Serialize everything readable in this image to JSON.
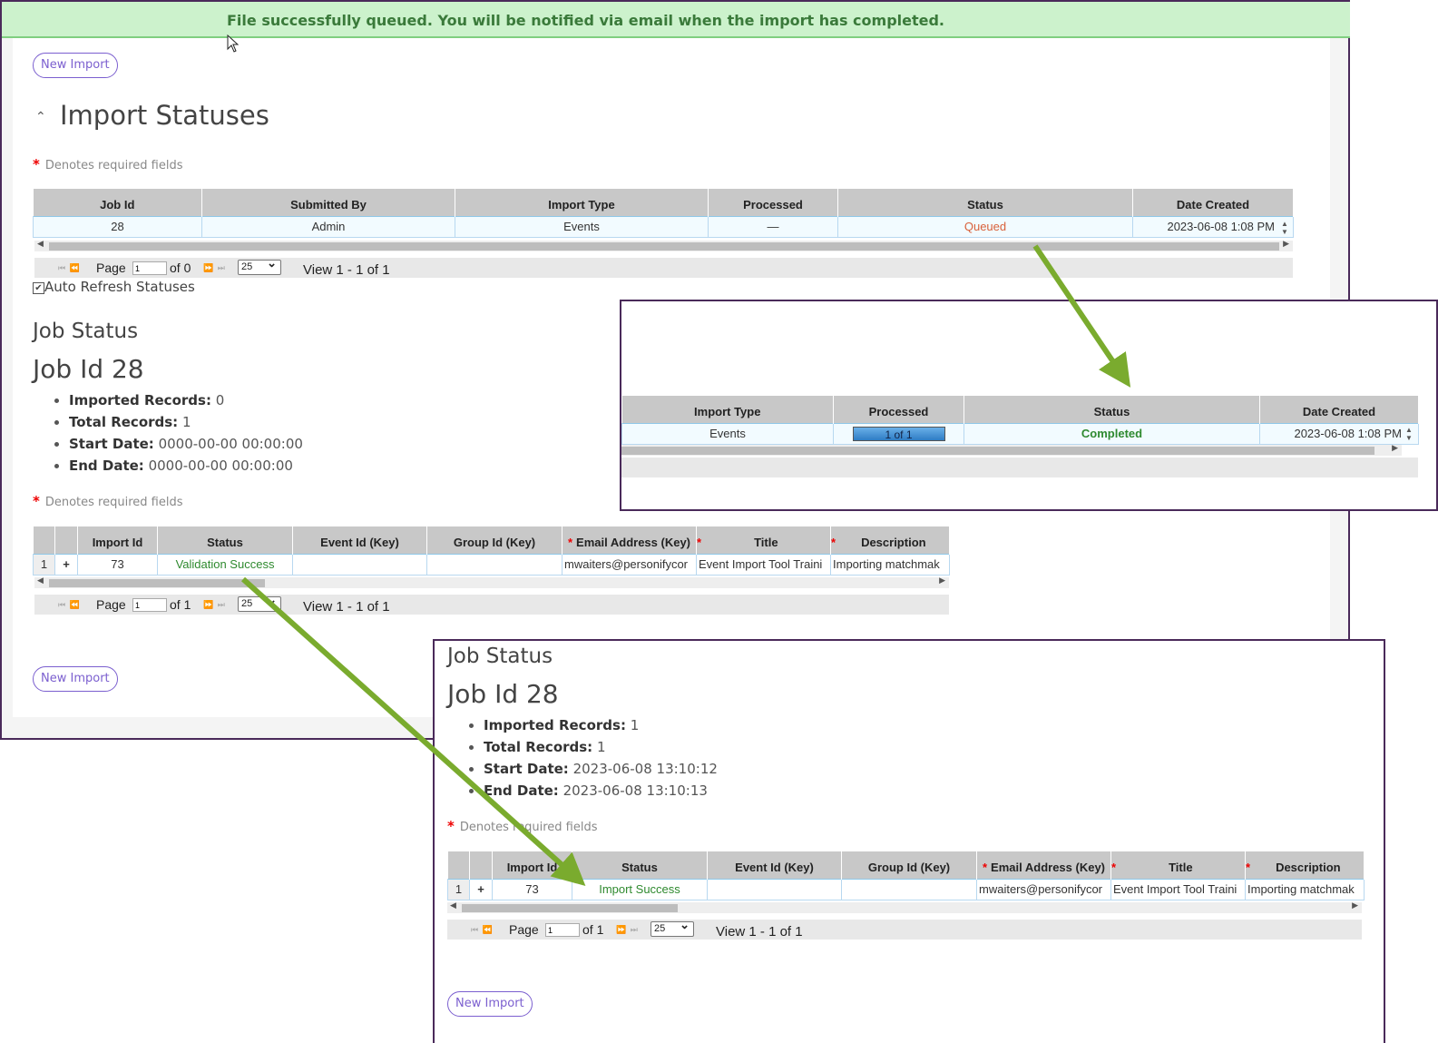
{
  "banner": {
    "message": "File successfully queued. You will be notified via email when the import has completed."
  },
  "buttons": {
    "new_import": "New Import"
  },
  "import_statuses": {
    "title": "Import Statuses",
    "required_note": "Denotes required fields",
    "columns": [
      "Job Id",
      "Submitted By",
      "Import Type",
      "Processed",
      "Status",
      "Date Created"
    ],
    "row": {
      "job_id": "28",
      "submitted_by": "Admin",
      "import_type": "Events",
      "processed": "—",
      "status": "Queued",
      "date_created": "2023-06-08 1:08 PM"
    },
    "pager": {
      "page_label": "Page",
      "page_value": "1",
      "of": "of 0",
      "per_page": "25",
      "view": "View 1 - 1 of 1"
    },
    "auto_refresh": "Auto Refresh Statuses"
  },
  "job_status_before": {
    "heading": "Job Status",
    "job_title": "Job Id 28",
    "stats": [
      {
        "label": "Imported Records:",
        "value": "0"
      },
      {
        "label": "Total Records:",
        "value": "1"
      },
      {
        "label": "Start Date:",
        "value": "0000-00-00 00:00:00"
      },
      {
        "label": "End Date:",
        "value": "0000-00-00 00:00:00"
      }
    ],
    "required_note": "Denotes required fields",
    "columns": [
      "Import Id",
      "Status",
      "Event Id (Key)",
      "Group Id (Key)",
      "Email Address (Key)",
      "Title",
      "Description"
    ],
    "row": {
      "num": "1",
      "expand": "+",
      "import_id": "73",
      "status": "Validation Success",
      "event_id": "",
      "group_id": "",
      "email": "mwaiters@personifycor",
      "title": "Event Import Tool Traini",
      "description": "Importing matchmak"
    },
    "pager": {
      "page_label": "Page",
      "page_value": "1",
      "of": "of 1",
      "per_page": "25",
      "view": "View 1 - 1 of 1"
    }
  },
  "status_zoom": {
    "columns": [
      "Import Type",
      "Processed",
      "Status",
      "Date Created"
    ],
    "row": {
      "import_type": "Events",
      "processed": "1 of 1",
      "processed_fraction": 1.0,
      "status": "Completed",
      "date_created": "2023-06-08 1:08 PM"
    }
  },
  "job_status_after": {
    "heading": "Job Status",
    "job_title": "Job Id 28",
    "stats": [
      {
        "label": "Imported Records:",
        "value": "1"
      },
      {
        "label": "Total Records:",
        "value": "1"
      },
      {
        "label": "Start Date:",
        "value": "2023-06-08 13:10:12"
      },
      {
        "label": "End Date:",
        "value": "2023-06-08 13:10:13"
      }
    ],
    "required_note": "Denotes required fields",
    "columns": [
      "Import Id",
      "Status",
      "Event Id (Key)",
      "Group Id (Key)",
      "Email Address (Key)",
      "Title",
      "Description"
    ],
    "row": {
      "num": "1",
      "expand": "+",
      "import_id": "73",
      "status": "Import Success",
      "event_id": "",
      "group_id": "",
      "email": "mwaiters@personifycor",
      "title": "Event Import Tool Traini",
      "description": "Importing matchmak"
    },
    "pager": {
      "page_label": "Page",
      "page_value": "1",
      "of": "of 1",
      "per_page": "25",
      "view": "View 1 - 1 of 1"
    }
  },
  "colors": {
    "accent": "#7b5fcf",
    "arrow": "#7aab2e",
    "success": "#2f8a2f",
    "queued": "#d9603a",
    "banner": "#ccf2cc"
  },
  "icons": {
    "collapse": "chevron-up-icon",
    "cursor": "mouse-pointer-icon",
    "required": "asterisk-icon"
  }
}
